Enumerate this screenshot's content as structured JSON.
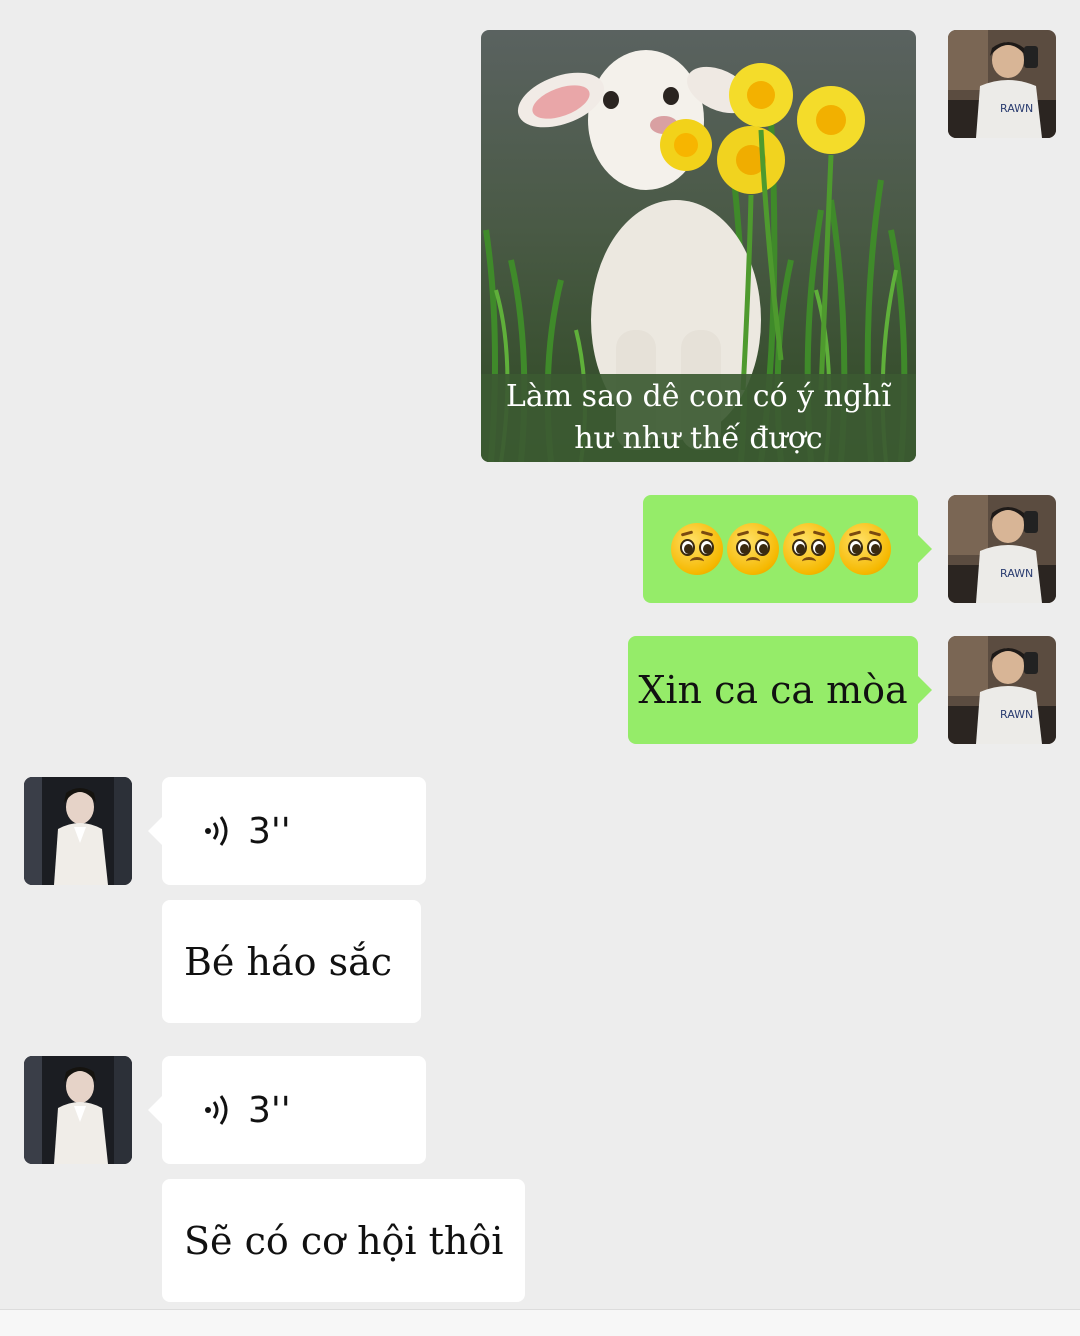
{
  "image_message": {
    "caption_line1": "Làm sao dê con có ý nghĩ",
    "caption_line2": "hư như thế được"
  },
  "messages": {
    "emoji_count": 4,
    "me_text": "Xin ca ca mòa",
    "voice1_duration": "3''",
    "them_text1": "Bé háo sắc",
    "voice2_duration": "3''",
    "them_text2": "Sẽ có cơ hội thôi"
  },
  "colors": {
    "background": "#ededed",
    "my_bubble": "#95ec69",
    "their_bubble": "#ffffff"
  },
  "icons": {
    "voice": "voice-wave-icon",
    "emoji": "pleading-face-emoji"
  }
}
